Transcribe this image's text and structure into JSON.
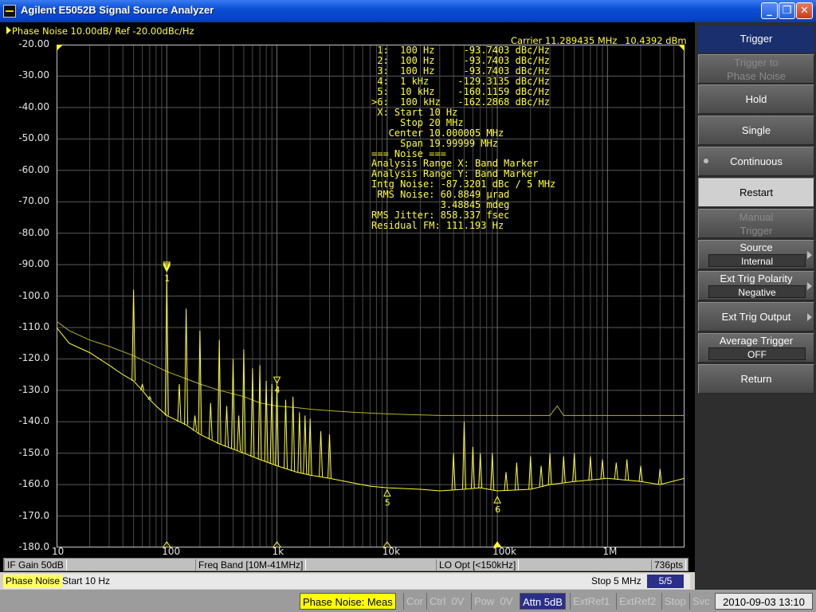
{
  "window": {
    "title": "Agilent E5052B Signal Source Analyzer",
    "min_icon": "minimize-icon",
    "max_icon": "maximize-icon",
    "close_icon": "close-icon"
  },
  "trace": {
    "header": "Phase Noise 10.00dB/ Ref -20.00dBc/Hz",
    "carrier": "Carrier 11.289435 MHz",
    "carrier_level": "10.4392 dBm"
  },
  "readout_lines": [
    " 1:  100 Hz     -93.7403 dBc/Hz",
    " 2:  100 Hz     -93.7403 dBc/Hz",
    " 3:  100 Hz     -93.7403 dBc/Hz",
    " 4:  1 kHz     -129.3135 dBc/Hz",
    " 5:  10 kHz    -160.1159 dBc/Hz",
    ">6:  100 kHz   -162.2868 dBc/Hz",
    " X: Start 10 Hz",
    "     Stop 20 MHz",
    "   Center 10.000005 MHz",
    "     Span 19.99999 MHz",
    "=== Noise ===",
    "Analysis Range X: Band Marker",
    "Analysis Range Y: Band Marker",
    "Intg Noise: -87.3201 dBc / 5 MHz",
    " RMS Noise: 60.8849 µrad",
    "            3.48845 mdeg",
    "RMS Jitter: 858.337 fsec",
    "Residual FM: 111.193 Hz"
  ],
  "chart_data": {
    "type": "line",
    "x_scale": "log",
    "xlim": [
      10,
      5000000
    ],
    "ylim": [
      -180,
      -20
    ],
    "y_ticks": [
      "-20.00",
      "-30.00",
      "-40.00",
      "-50.00",
      "-60.00",
      "-70.00",
      "-80.00",
      "-90.00",
      "-100.0",
      "-110.0",
      "-120.0",
      "-130.0",
      "-140.0",
      "-150.0",
      "-160.0",
      "-170.0",
      "-180.0"
    ],
    "x_ticks": [
      {
        "value": 10,
        "label": "10"
      },
      {
        "value": 100,
        "label": "100"
      },
      {
        "value": 1000,
        "label": "1k"
      },
      {
        "value": 10000,
        "label": "10k"
      },
      {
        "value": 100000,
        "label": "100k"
      },
      {
        "value": 1000000,
        "label": "1M"
      }
    ],
    "grid": true,
    "series": [
      {
        "role": "spur-trace",
        "color": "#ffff33",
        "x": [
          10,
          13,
          20,
          30,
          40,
          50,
          60,
          70,
          80,
          100,
          150,
          200,
          300,
          500,
          700,
          1000,
          1500,
          2000,
          3000,
          5000,
          7000,
          10000,
          20000,
          30000,
          50000,
          70000,
          100000,
          200000,
          300000,
          500000,
          1000000,
          2000000,
          3000000,
          5000000
        ],
        "y": [
          -110,
          -115,
          -118,
          -122,
          -125,
          -127,
          -130,
          -133,
          -135,
          -138,
          -141,
          -144,
          -147,
          -150,
          -152,
          -154,
          -156,
          -157,
          -158,
          -159.5,
          -160.5,
          -161,
          -161.5,
          -162,
          -161.5,
          -161,
          -162,
          -161.5,
          -160,
          -159,
          -158,
          -159,
          -160,
          -158
        ]
      },
      {
        "role": "smooth-trace",
        "color": "#b4b428",
        "x": [
          10,
          13,
          20,
          30,
          50,
          100,
          200,
          300,
          500,
          700,
          1000,
          1500,
          2000,
          3000,
          5000,
          10000,
          30000,
          100000,
          200000,
          300000,
          350000,
          400000,
          1000000,
          5000000
        ],
        "y": [
          -108,
          -111,
          -114,
          -116,
          -119,
          -124,
          -128,
          -130,
          -132,
          -134,
          -135,
          -135.5,
          -136,
          -136.5,
          -137,
          -137.5,
          -138,
          -138,
          -138,
          -138,
          -135,
          -138,
          -138,
          -138
        ]
      }
    ],
    "spurs": [
      {
        "x": 50,
        "y": -98
      },
      {
        "x": 60,
        "y": -128
      },
      {
        "x": 70,
        "y": -132
      },
      {
        "x": 100,
        "y": -93
      },
      {
        "x": 130,
        "y": -128
      },
      {
        "x": 150,
        "y": -104
      },
      {
        "x": 180,
        "y": -138
      },
      {
        "x": 200,
        "y": -111
      },
      {
        "x": 250,
        "y": -134
      },
      {
        "x": 300,
        "y": -114
      },
      {
        "x": 350,
        "y": -135
      },
      {
        "x": 400,
        "y": -120
      },
      {
        "x": 450,
        "y": -138
      },
      {
        "x": 500,
        "y": -117
      },
      {
        "x": 600,
        "y": -123
      },
      {
        "x": 700,
        "y": -122
      },
      {
        "x": 800,
        "y": -127
      },
      {
        "x": 900,
        "y": -128
      },
      {
        "x": 1000,
        "y": -128
      },
      {
        "x": 1200,
        "y": -133
      },
      {
        "x": 1400,
        "y": -132
      },
      {
        "x": 1600,
        "y": -137
      },
      {
        "x": 1800,
        "y": -138
      },
      {
        "x": 2000,
        "y": -139
      },
      {
        "x": 2500,
        "y": -143
      },
      {
        "x": 3000,
        "y": -144
      },
      {
        "x": 40000,
        "y": -150
      },
      {
        "x": 50000,
        "y": -140
      },
      {
        "x": 60000,
        "y": -148
      },
      {
        "x": 70000,
        "y": -150
      },
      {
        "x": 90000,
        "y": -150
      },
      {
        "x": 120000,
        "y": -156
      },
      {
        "x": 150000,
        "y": -153
      },
      {
        "x": 200000,
        "y": -151
      },
      {
        "x": 250000,
        "y": -154
      },
      {
        "x": 300000,
        "y": -150
      },
      {
        "x": 400000,
        "y": -151
      },
      {
        "x": 500000,
        "y": -150
      },
      {
        "x": 700000,
        "y": -151
      },
      {
        "x": 900000,
        "y": -152
      },
      {
        "x": 1200000,
        "y": -153
      },
      {
        "x": 1500000,
        "y": -152
      },
      {
        "x": 2000000,
        "y": -154
      },
      {
        "x": 3000000,
        "y": -155
      }
    ],
    "markers": [
      {
        "label": "1",
        "x": 100,
        "y": -93.7403
      },
      {
        "label": "2",
        "x": 100,
        "y": -93.7403
      },
      {
        "label": "3",
        "x": 100,
        "y": -93.7403
      },
      {
        "label": "4",
        "x": 1000,
        "y": -129.3135
      },
      {
        "label": "5",
        "x": 10000,
        "y": -160.1159
      },
      {
        "label": "6",
        "x": 100000,
        "y": -162.2868
      }
    ],
    "axis_marker_positions": [
      100,
      1000,
      10000,
      100000
    ]
  },
  "status1": {
    "if_gain": "IF Gain 50dB",
    "freq_band": "Freq Band [10M-41MHz]",
    "lo_opt": "LO Opt [<150kHz]",
    "points": "736pts"
  },
  "status2": {
    "measure": "Phase Noise",
    "start": "Start 10 Hz",
    "stop": "Stop 5 MHz",
    "channel": "5/5"
  },
  "bottombar": {
    "meas": "Phase Noise: Meas",
    "cor": "Cor",
    "ctrl": "Ctrl",
    "ctrl_v": "0V",
    "pow": "Pow",
    "pow_v": "0V",
    "attn": "Attn 5dB",
    "extref1": "ExtRef1",
    "extref2": "ExtRef2",
    "stop": "Stop",
    "svc": "Svc",
    "datetime": "2010-09-03  13:10"
  },
  "softkeys": {
    "title": "Trigger",
    "trigger_to_phase_noise": [
      "Trigger to",
      "Phase Noise"
    ],
    "hold": "Hold",
    "single": "Single",
    "continuous": "Continuous",
    "restart": "Restart",
    "manual_trigger": [
      "Manual",
      "Trigger"
    ],
    "source_label": "Source",
    "source_value": "Internal",
    "ext_trig_polarity_label": "Ext Trig Polarity",
    "ext_trig_polarity_value": "Negative",
    "ext_trig_output": "Ext Trig Output",
    "average_trigger_label": "Average Trigger",
    "average_trigger_value": "OFF",
    "return": "Return"
  }
}
